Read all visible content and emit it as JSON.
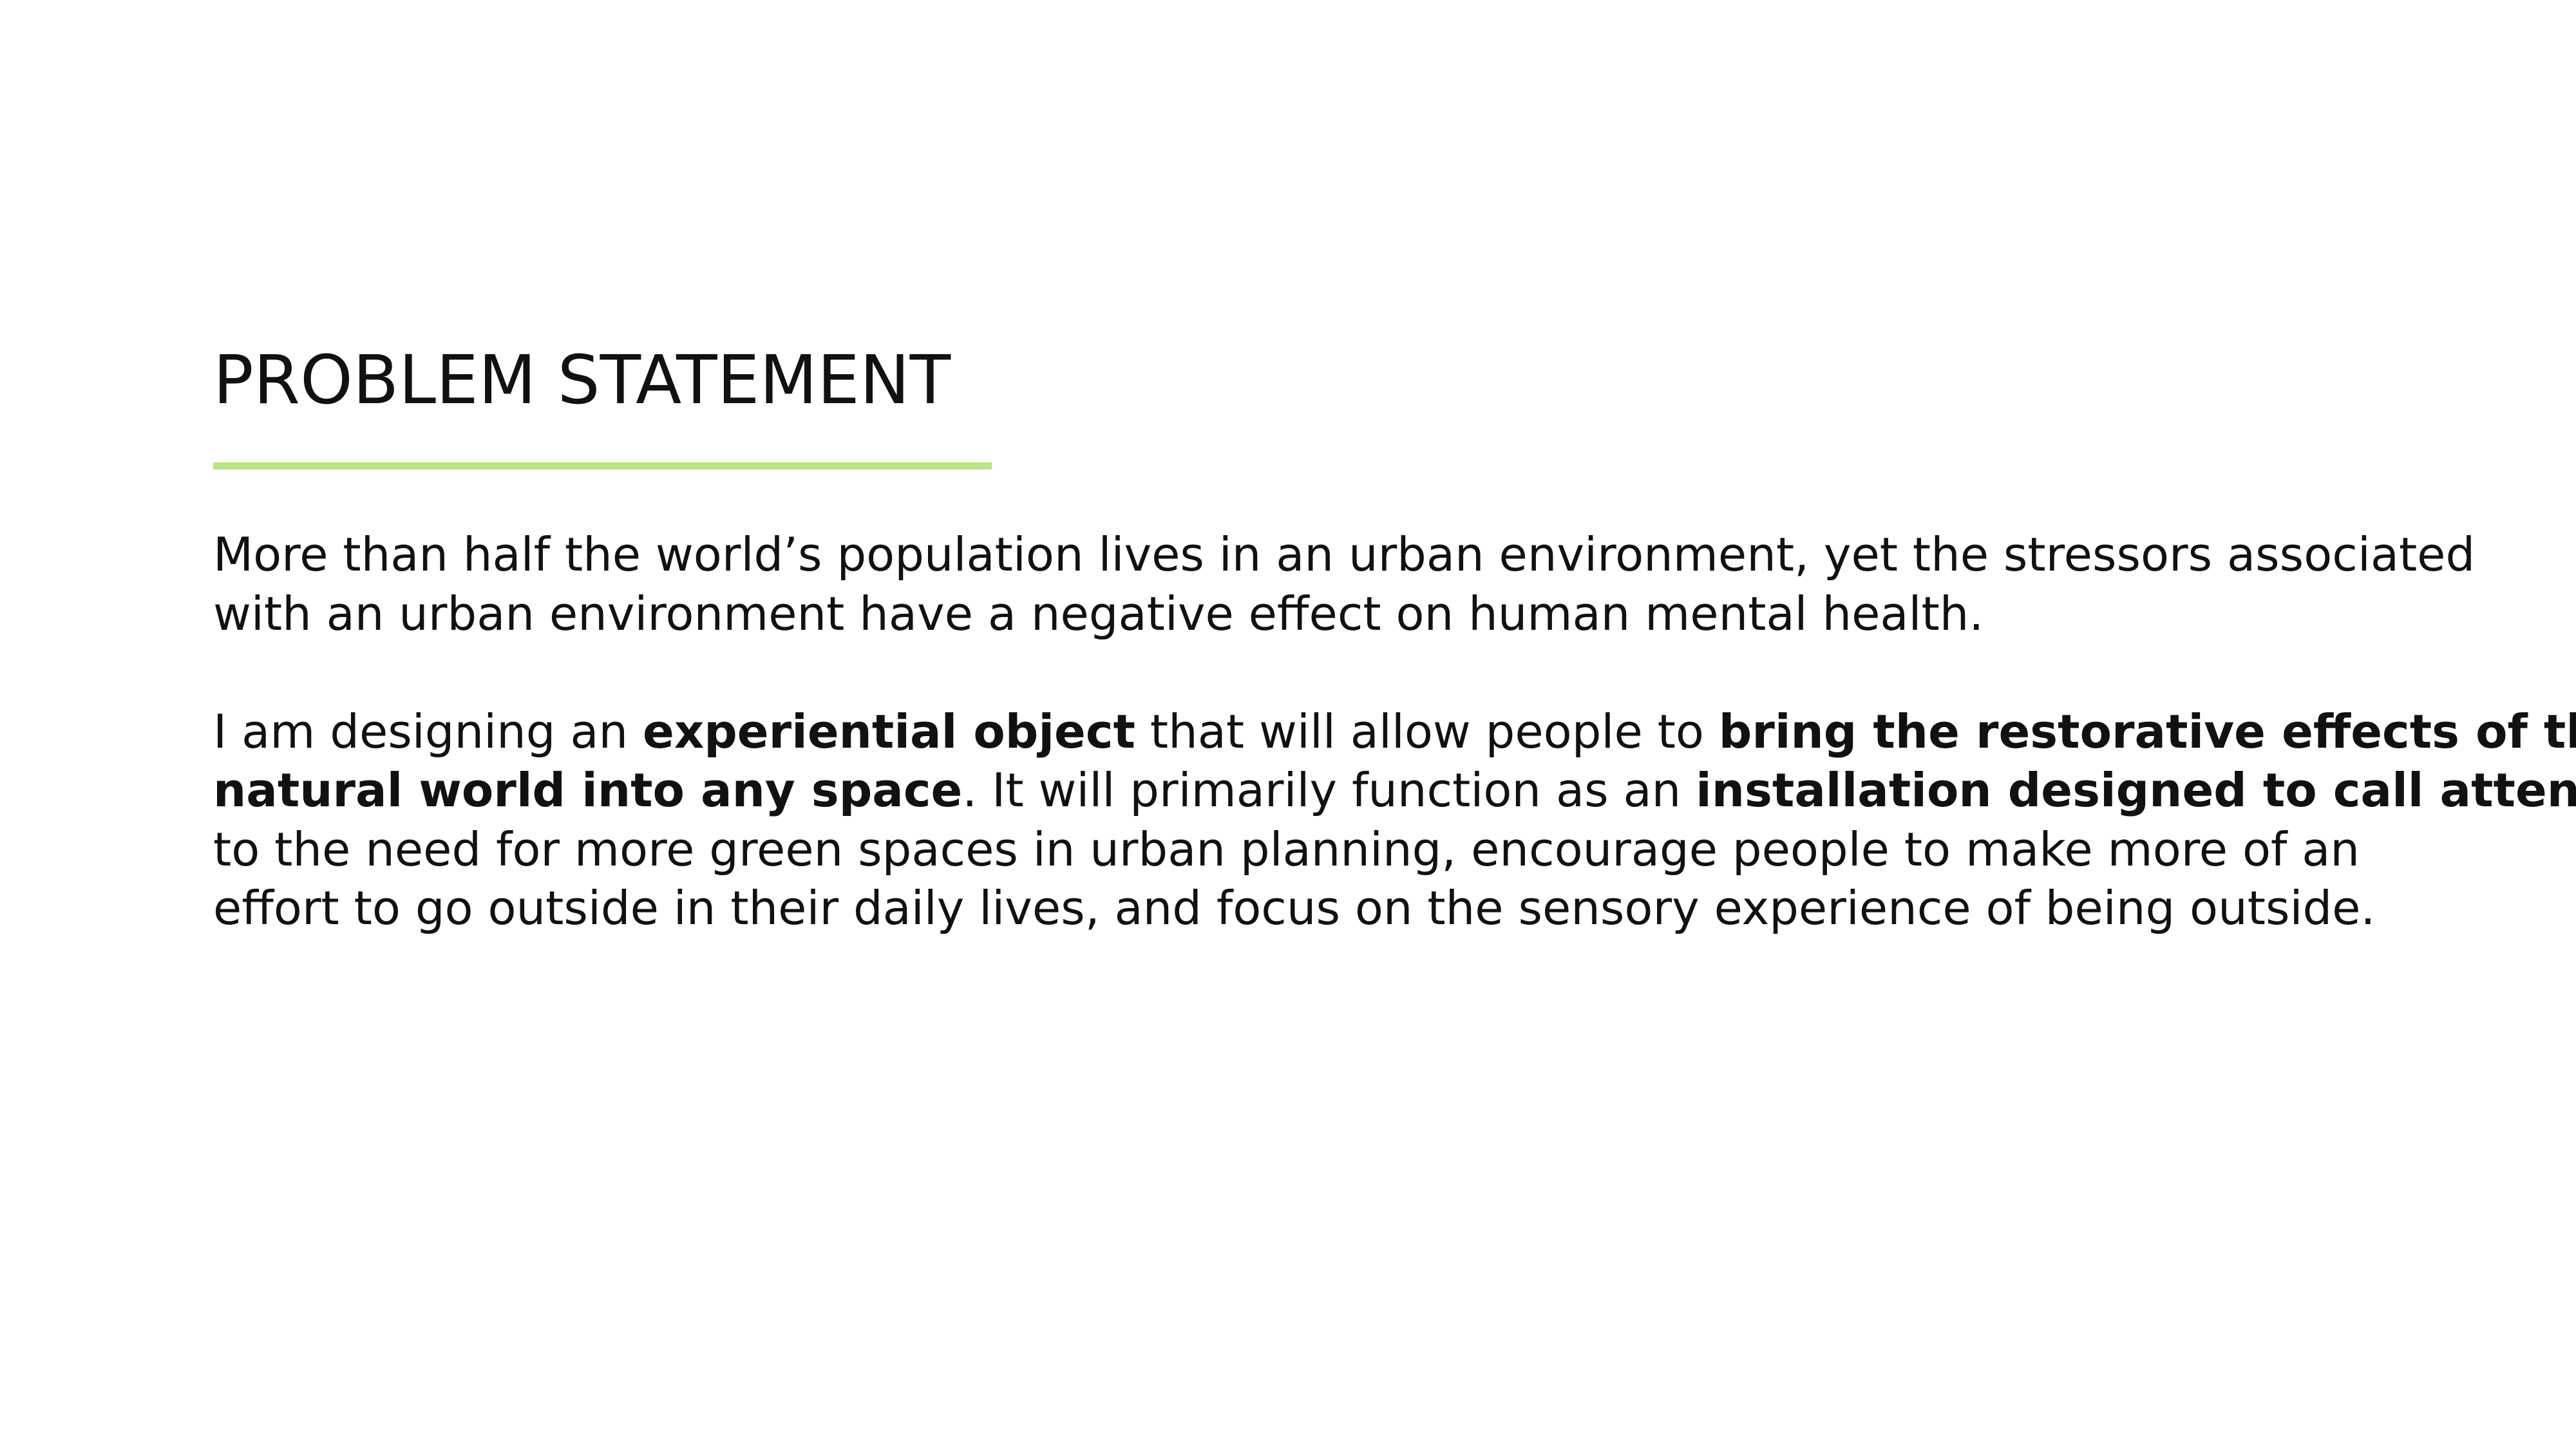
{
  "slide": {
    "title": "PROBLEM STATEMENT",
    "accent_color": "#b9e586",
    "paragraph1": {
      "line1": "More than half the world’s population lives in an urban environment, yet the stressors associated",
      "line2": "with an urban environment have a negative effect on human mental health."
    },
    "paragraph2": {
      "l1_a": "I am designing an ",
      "l1_b": "experiential object",
      "l1_c": " that will allow people to ",
      "l1_d": "bring the restorative effects of the",
      "l2_a": "natural world into any space",
      "l2_b": ". It will primarily function as an ",
      "l2_c": "installation designed to call attention",
      "l3": "to the need for more green spaces in urban planning, encourage people to make more of an",
      "l4": "effort to go outside in their daily lives, and focus on the sensory experience of being outside."
    }
  }
}
